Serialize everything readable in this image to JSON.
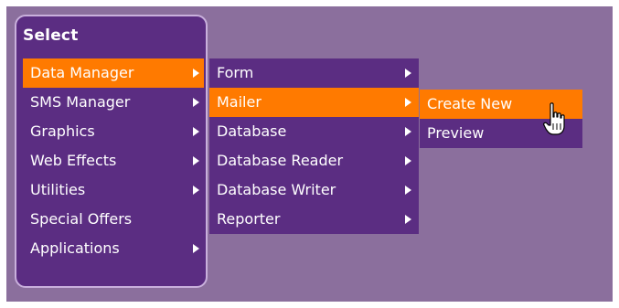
{
  "panel": {
    "title": "Select"
  },
  "menu_level1": [
    {
      "label": "Data Manager",
      "arrow": true,
      "active": true
    },
    {
      "label": "SMS Manager",
      "arrow": true
    },
    {
      "label": "Graphics",
      "arrow": true
    },
    {
      "label": "Web Effects",
      "arrow": true
    },
    {
      "label": "Utilities",
      "arrow": true
    },
    {
      "label": "Special Offers",
      "arrow": false
    },
    {
      "label": "Applications",
      "arrow": true
    }
  ],
  "menu_level2": [
    {
      "label": "Form",
      "arrow": true
    },
    {
      "label": "Mailer",
      "arrow": true,
      "active": true
    },
    {
      "label": "Database",
      "arrow": true
    },
    {
      "label": "Database Reader",
      "arrow": true
    },
    {
      "label": "Database Writer",
      "arrow": true
    },
    {
      "label": "Reporter",
      "arrow": true
    }
  ],
  "menu_level3": [
    {
      "label": "Create New",
      "active": true
    },
    {
      "label": "Preview"
    }
  ],
  "colors": {
    "background": "#8b6f9d",
    "menu": "#5b2d82",
    "highlight": "#ff7a00"
  },
  "cursor": "hand-pointer-icon"
}
